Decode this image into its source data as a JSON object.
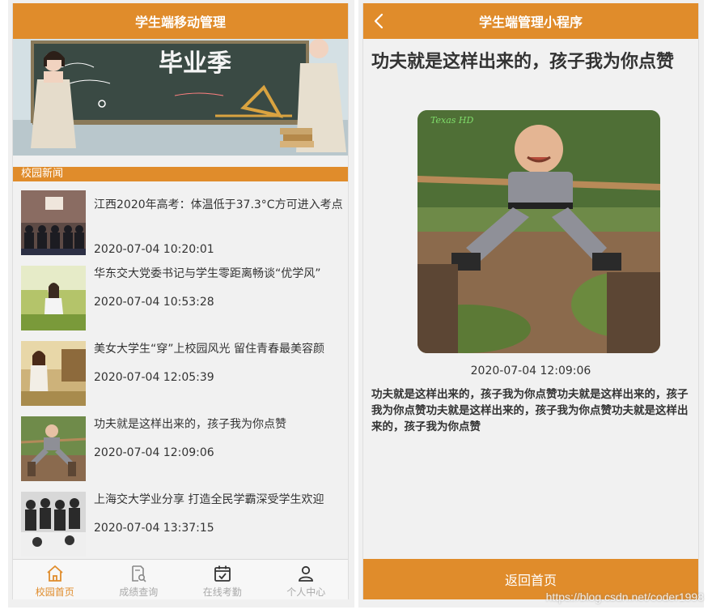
{
  "left": {
    "navbar_title": "学生端移动管理",
    "banner_text": "毕业季",
    "section_title": "校园新闻",
    "news": [
      {
        "title": "江西2020年高考：体温低于37.3°C方可进入考点",
        "time": "2020-07-04 10:20:01"
      },
      {
        "title": "华东交大党委书记与学生零距离畅谈“优学风”",
        "time": "2020-07-04 10:53:28"
      },
      {
        "title": "美女大学生“穿”上校园风光 留住青春最美容颜",
        "time": "2020-07-04 12:05:39"
      },
      {
        "title": "功夫就是这样出来的，孩子我为你点赞",
        "time": "2020-07-04 12:09:06"
      },
      {
        "title": "上海交大学业分享 打造全民学霸深受学生欢迎",
        "time": "2020-07-04 13:37:15"
      }
    ],
    "tabs": [
      {
        "label": "校园首页",
        "icon": "home-icon",
        "active": true
      },
      {
        "label": "成绩查询",
        "icon": "score-search-icon",
        "active": false
      },
      {
        "label": "在线考勤",
        "icon": "calendar-check-icon",
        "active": false
      },
      {
        "label": "个人中心",
        "icon": "user-icon",
        "active": false
      }
    ]
  },
  "right": {
    "navbar_title": "学生端管理小程序",
    "detail_title": "功夫就是这样出来的，孩子我为你点赞",
    "image_caption": "Texas HD",
    "detail_time": "2020-07-04 12:09:06",
    "detail_body": "功夫就是这样出来的，孩子我为你点赞功夫就是这样出来的，孩子我为你点赞功夫就是这样出来的，孩子我为你点赞功夫就是这样出来的，孩子我为你点赞",
    "back_button": "返回首页"
  },
  "watermark": "https://blog.csdn.net/coder1998",
  "colors": {
    "accent": "#e08c2b",
    "background": "#f1f1f1",
    "inactive": "#aaaaaa"
  }
}
